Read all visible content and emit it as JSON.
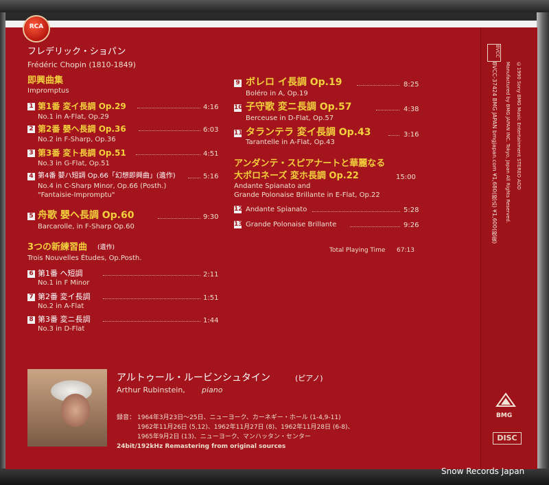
{
  "header": {
    "composer_jp": "フレデリック・ショパン",
    "composer_en": "Frédéric Chopin (1810-1849)"
  },
  "impromptus": {
    "title_jp": "即興曲集",
    "title_en": "Impromptus",
    "tracks": [
      {
        "no": "1",
        "jp": "第1番 変イ長調 Op.29",
        "en": "No.1 in A-Flat, Op.29",
        "time": "4:16"
      },
      {
        "no": "2",
        "jp": "第2番 嬰ヘ長調 Op.36",
        "en": "No.2 in F-Sharp, Op.36",
        "time": "6:03"
      },
      {
        "no": "3",
        "jp": "第3番 変ト長調 Op.51",
        "en": "No.3 in G-Flat, Op.51",
        "time": "4:51"
      },
      {
        "no": "4",
        "jp": "第4番 嬰ハ短調 Op.66「幻想即興曲」(遺作)",
        "en": "No.4 in C-Sharp Minor, Op.66 (Posth.)",
        "en2": "\"Fantaisie-Impromptu\"",
        "time": "5:16"
      }
    ]
  },
  "barcarolle": {
    "no": "5",
    "jp": "舟歌 嬰ヘ長調 Op.60",
    "en": "Barcarolle, in F-Sharp Op.60",
    "time": "9:30"
  },
  "etudes": {
    "title_jp": "3つの新練習曲",
    "title_tag": "(遺作)",
    "title_en": "Trois Nouvelles Études, Op.Posth.",
    "tracks": [
      {
        "no": "6",
        "jp": "第1番 ヘ短調",
        "en": "No.1 in F Minor",
        "time": "2:11"
      },
      {
        "no": "7",
        "jp": "第2番 変イ長調",
        "en": "No.2 in A-Flat",
        "time": "1:51"
      },
      {
        "no": "8",
        "jp": "第3番 変ニ長調",
        "en": "No.3 in D-Flat",
        "time": "1:44"
      }
    ]
  },
  "right_tracks": [
    {
      "no": "9",
      "jp": "ボレロ イ長調 Op.19",
      "en": "Boléro in A, Op.19",
      "time": "8:25"
    },
    {
      "no": "10",
      "jp": "子守歌 変ニ長調 Op.57",
      "en": "Berceuse in D-Flat, Op.57",
      "time": "4:38"
    },
    {
      "no": "11",
      "jp": "タランテラ 変イ長調 Op.43",
      "en": "Tarantelle in A-Flat, Op.43",
      "time": "3:16"
    }
  ],
  "andante": {
    "jp1": "アンダンテ・スピアナートと華麗なる",
    "jp2": "大ポロネーズ 変ホ長調 Op.22",
    "time": "15:00",
    "en1": "Andante Spianato and",
    "en2": "Grande Polonaise Brillante in E-Flat, Op.22",
    "subtracks": [
      {
        "no": "12",
        "en": "Andante Spianato",
        "time": "5:28"
      },
      {
        "no": "13",
        "en": "Grande Polonaise Brillante",
        "time": "9:26"
      }
    ]
  },
  "total": {
    "label": "Total Playing Time",
    "time": "67:13"
  },
  "artist": {
    "jp": "アルトゥール・ルービンシュタイン",
    "jp_role": "(ピアノ)",
    "en": "Arthur Rubinstein,",
    "en_role": "piano"
  },
  "recording": {
    "label": "録音：",
    "lines": [
      "1964年3月23日〜25日、ニューヨーク、カーネギー・ホール (1-4,9-11)",
      "1962年11月26日 (5,12)、1962年11月27日 (8)、1962年11月28日 (6-8)、",
      "1965年9月2日 (13)、ニューヨーク、マンハッタン・センター"
    ],
    "remaster": "24bit/192kHz Remastering from original sources"
  },
  "logos": {
    "rca": "RCA",
    "bmg": "BMG",
    "disc": "DISC"
  },
  "spine": {
    "line1": "BVCC-37424 BMG JAPAN bmgjapan.com ¥1,680(税込) ¥1,600(税抜)",
    "line2": "Manufactured by BMG JAPAN INC. Tokyo, Japan All Rights Reserved.",
    "line3": "©1990 Sony BMG Music Entertainment STEREO ADD",
    "code": "BVCC"
  },
  "watermark": "Snow Records Japan"
}
